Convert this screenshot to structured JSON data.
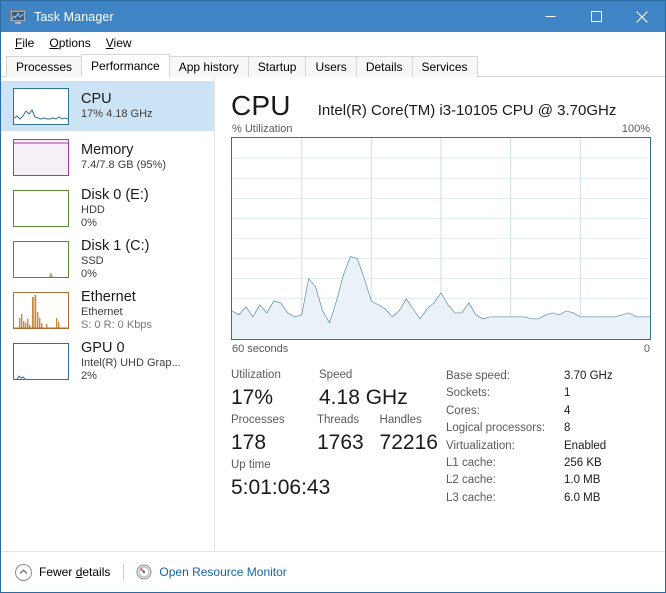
{
  "window": {
    "title": "Task Manager",
    "icon": "task-manager-icon",
    "controls": {
      "minimize": "minimize-icon",
      "maximize": "maximize-icon",
      "close": "close-icon"
    }
  },
  "menubar": {
    "items": [
      {
        "label": "File",
        "accel": "F"
      },
      {
        "label": "Options",
        "accel": "O"
      },
      {
        "label": "View",
        "accel": "V"
      }
    ]
  },
  "tabs": {
    "items": [
      {
        "label": "Processes",
        "active": false
      },
      {
        "label": "Performance",
        "active": true
      },
      {
        "label": "App history",
        "active": false
      },
      {
        "label": "Startup",
        "active": false
      },
      {
        "label": "Users",
        "active": false
      },
      {
        "label": "Details",
        "active": false
      },
      {
        "label": "Services",
        "active": false
      }
    ]
  },
  "sidebar": {
    "items": [
      {
        "key": "cpu",
        "title": "CPU",
        "sub1": "17%  4.18 GHz",
        "sub2": "",
        "selected": true,
        "color": "#2f7391",
        "fill": "#eef4f9"
      },
      {
        "key": "memory",
        "title": "Memory",
        "sub1": "7.4/7.8 GB (95%)",
        "sub2": "",
        "selected": false,
        "color": "#a33ba3",
        "fill": "#f7eff7"
      },
      {
        "key": "disk0",
        "title": "Disk 0 (E:)",
        "sub1": "HDD",
        "sub2": "0%",
        "selected": false,
        "color": "#5a8a33",
        "fill": "#ffffff"
      },
      {
        "key": "disk1",
        "title": "Disk 1 (C:)",
        "sub1": "SSD",
        "sub2": "0%",
        "selected": false,
        "color": "#5a8a33",
        "fill": "#ffffff"
      },
      {
        "key": "ethernet",
        "title": "Ethernet",
        "sub1": "Ethernet",
        "sub2": "S: 0 R: 0 Kbps",
        "sub2_gray": true,
        "selected": false,
        "color": "#b06e2a",
        "fill": "#ffffff"
      },
      {
        "key": "gpu0",
        "title": "GPU 0",
        "sub1": "Intel(R) UHD Grap...",
        "sub2": "2%",
        "selected": false,
        "color": "#2f6f9e",
        "fill": "#ffffff"
      }
    ]
  },
  "main": {
    "heading": "CPU",
    "model": "Intel(R) Core(TM) i3-10105 CPU @ 3.70GHz",
    "axis_label": "% Utilization",
    "axis_max": "100%",
    "time_left": "60 seconds",
    "time_right": "0",
    "stats": {
      "row1": [
        {
          "label": "Utilization",
          "value": "17%"
        },
        {
          "label": "Speed",
          "value": "4.18 GHz"
        }
      ],
      "row2": [
        {
          "label": "Processes",
          "value": "178"
        },
        {
          "label": "Threads",
          "value": "1763"
        },
        {
          "label": "Handles",
          "value": "72216"
        }
      ],
      "row3": [
        {
          "label": "Up time",
          "value": "5:01:06:43"
        }
      ]
    },
    "specs": [
      {
        "key": "Base speed:",
        "value": "3.70 GHz"
      },
      {
        "key": "Sockets:",
        "value": "1"
      },
      {
        "key": "Cores:",
        "value": "4"
      },
      {
        "key": "Logical processors:",
        "value": "8"
      },
      {
        "key": "Virtualization:",
        "value": "Enabled"
      },
      {
        "key": "L1 cache:",
        "value": "256 KB"
      },
      {
        "key": "L2 cache:",
        "value": "1.0 MB"
      },
      {
        "key": "L3 cache:",
        "value": "6.0 MB"
      }
    ]
  },
  "statusbar": {
    "fewer_details": "Fewer details",
    "fewer_details_accel": "d",
    "open_resource_monitor": "Open Resource Monitor"
  },
  "colors": {
    "titlebar": "#3f85c6",
    "selection": "#cce3f5",
    "graph_line": "#2f7391",
    "graph_fill": "#eef4f9",
    "graph_grid": "#cfe0e8",
    "link": "#1464a8"
  },
  "chart_data": {
    "type": "area",
    "title": "CPU % Utilization over 60 seconds",
    "xlabel": "60 seconds",
    "ylabel": "% Utilization",
    "ylim": [
      0,
      100
    ],
    "xlim": [
      60,
      0
    ],
    "grid": true,
    "grid_cols": 6,
    "grid_rows": 10,
    "legend": "none",
    "series": [
      {
        "name": "CPU Utilization",
        "color": "#2f7391",
        "values": [
          14,
          12,
          16,
          11,
          17,
          13,
          19,
          18,
          13,
          11,
          12,
          30,
          26,
          14,
          8,
          19,
          32,
          41,
          40,
          30,
          19,
          17,
          15,
          11,
          14,
          20,
          15,
          10,
          15,
          18,
          23,
          17,
          13,
          13,
          18,
          12,
          10,
          11,
          11,
          11,
          11,
          11,
          11,
          10,
          10,
          12,
          13,
          12,
          14,
          13,
          11,
          11,
          11,
          11,
          11,
          11,
          12,
          13,
          11,
          11,
          11
        ]
      }
    ]
  }
}
